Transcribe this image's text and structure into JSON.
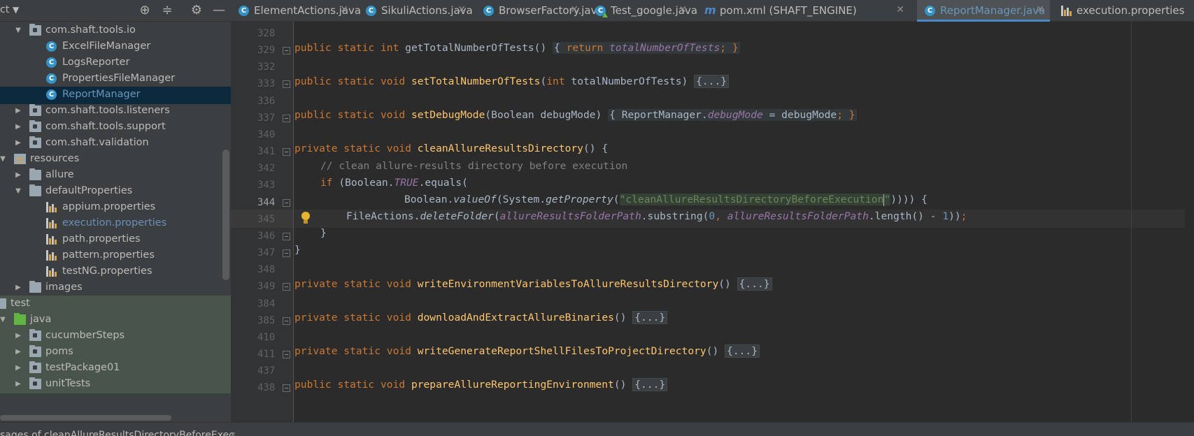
{
  "project_panel": {
    "title": "ct",
    "icons": [
      "locate-icon",
      "collapse-icon",
      "gear-icon",
      "minimize-icon"
    ],
    "tree": [
      {
        "label": "com.shaft.tools.io",
        "icon": "package",
        "expanded": true,
        "depth": 1
      },
      {
        "label": "ExcelFileManager",
        "icon": "class",
        "depth": 2
      },
      {
        "label": "LogsReporter",
        "icon": "class",
        "depth": 2
      },
      {
        "label": "PropertiesFileManager",
        "icon": "class",
        "depth": 2
      },
      {
        "label": "ReportManager",
        "icon": "class",
        "depth": 2,
        "selected": true
      },
      {
        "label": "com.shaft.tools.listeners",
        "icon": "package",
        "expanded": false,
        "depth": 1
      },
      {
        "label": "com.shaft.tools.support",
        "icon": "package",
        "expanded": false,
        "depth": 1
      },
      {
        "label": "com.shaft.validation",
        "icon": "package",
        "expanded": false,
        "depth": 1
      },
      {
        "label": "resources",
        "icon": "resources",
        "expanded": true,
        "depth": 0
      },
      {
        "label": "allure",
        "icon": "folder",
        "expanded": false,
        "depth": 1
      },
      {
        "label": "defaultProperties",
        "icon": "folder",
        "expanded": true,
        "depth": 1
      },
      {
        "label": "appium.properties",
        "icon": "properties",
        "depth": 2
      },
      {
        "label": "execution.properties",
        "icon": "properties",
        "depth": 2,
        "highlight": true
      },
      {
        "label": "path.properties",
        "icon": "properties",
        "depth": 2
      },
      {
        "label": "pattern.properties",
        "icon": "properties",
        "depth": 2
      },
      {
        "label": "testNG.properties",
        "icon": "properties",
        "depth": 2
      },
      {
        "label": "images",
        "icon": "folder",
        "expanded": false,
        "depth": 1
      },
      {
        "label": "test",
        "icon": "folder",
        "depth": -1,
        "test": true
      },
      {
        "label": "java",
        "icon": "folder-green",
        "expanded": true,
        "depth": 0,
        "test": true
      },
      {
        "label": "cucumberSteps",
        "icon": "package",
        "expanded": false,
        "depth": 1,
        "test": true
      },
      {
        "label": "poms",
        "icon": "package",
        "expanded": false,
        "depth": 1,
        "test": true
      },
      {
        "label": "testPackage01",
        "icon": "package",
        "expanded": false,
        "depth": 1,
        "test": true
      },
      {
        "label": "unitTests",
        "icon": "package",
        "expanded": false,
        "depth": 1,
        "test": true
      }
    ]
  },
  "tabs": [
    {
      "label": "ElementActions.java",
      "icon": "class",
      "active": false
    },
    {
      "label": "SikuliActions.java",
      "icon": "class",
      "active": false
    },
    {
      "label": "BrowserFactory.java",
      "icon": "class",
      "active": false
    },
    {
      "label": "Test_google.java",
      "icon": "test-class",
      "active": false
    },
    {
      "label": "pom.xml (SHAFT_ENGINE)",
      "icon": "maven",
      "active": false
    },
    {
      "label": "ReportManager.java",
      "icon": "class",
      "active": true
    },
    {
      "label": "execution.properties",
      "icon": "properties",
      "active": false
    }
  ],
  "editor": {
    "current_line": "344",
    "lines": [
      {
        "no": "328",
        "fold": false
      },
      {
        "no": "329",
        "fold": true
      },
      {
        "no": "332",
        "fold": false
      },
      {
        "no": "333",
        "fold": true
      },
      {
        "no": "336",
        "fold": false
      },
      {
        "no": "337",
        "fold": true
      },
      {
        "no": "340",
        "fold": false
      },
      {
        "no": "341",
        "fold": true
      },
      {
        "no": "342",
        "fold": false
      },
      {
        "no": "343",
        "fold": false
      },
      {
        "no": "344",
        "fold": true
      },
      {
        "no": "345",
        "fold": false
      },
      {
        "no": "346",
        "fold": true
      },
      {
        "no": "347",
        "fold": true
      },
      {
        "no": "348",
        "fold": false
      },
      {
        "no": "349",
        "fold": true
      },
      {
        "no": "384",
        "fold": false
      },
      {
        "no": "385",
        "fold": true
      },
      {
        "no": "410",
        "fold": false
      },
      {
        "no": "411",
        "fold": true
      },
      {
        "no": "437",
        "fold": false
      },
      {
        "no": "438",
        "fold": true
      }
    ],
    "code": {
      "l329": {
        "mod": "public static int ",
        "fn": "getTotalNumberOfTests",
        "paren": "() ",
        "fold_open": "{ ",
        "ret": "return ",
        "field": "totalNumberOfTests",
        "fold_close": "; }"
      },
      "l333": {
        "mod": "public static void ",
        "fn": "setTotalNumberOfTests",
        "p1": "(",
        "type": "int ",
        "p2": "totalNumberOfTests) ",
        "folded": "{...}"
      },
      "l337": {
        "mod": "public static void ",
        "fn": "setDebugMode",
        "p1": "(Boolean debugMode) ",
        "fold_open": "{ ",
        "cls": "ReportManager.",
        "field": "debugMode",
        "rest": " = debugMode",
        "fold_close": "; }"
      },
      "l341": {
        "mod": "private static void ",
        "fn": "cleanAllureResultsDirectory",
        "rest": "() {"
      },
      "l342": {
        "comment": "// clean allure-results directory before execution"
      },
      "l343": {
        "kw": "if ",
        "p1": "(Boolean.",
        "const": "TRUE",
        "p2": ".equals("
      },
      "l344": {
        "p1": "Boolean.",
        "m1": "valueOf",
        "p2": "(System.",
        "m2": "getProperty",
        "p3": "(",
        "q1": "\"",
        "str": "cleanAllureResultsDirectoryBeforeExecution",
        "q2": "\"",
        "p4": ")))) {"
      },
      "l345": {
        "p1": "FileActions.",
        "m1": "deleteFolder",
        "p2": "(",
        "f1": "allureResultsFolderPath",
        "p3": ".substring(",
        "n1": "0",
        "comma": ", ",
        "f2": "allureResultsFolderPath",
        "p4": ".length() - ",
        "n2": "1",
        "p5": "))",
        "semi": ";"
      },
      "l346": {
        "text": "}"
      },
      "l347": {
        "text": "}"
      },
      "l349": {
        "mod": "private static void ",
        "fn": "writeEnvironmentVariablesToAllureResultsDirectory",
        "paren": "() ",
        "folded": "{...}"
      },
      "l385": {
        "mod": "private static void ",
        "fn": "downloadAndExtractAllureBinaries",
        "paren": "() ",
        "folded": "{...}"
      },
      "l411": {
        "mod": "private static void ",
        "fn": "writeGenerateReportShellFilesToProjectDirectory",
        "paren": "() ",
        "folded": "{...}"
      },
      "l438": {
        "mod": "public static void ",
        "fn": "prepareAllureReportingEnvironment",
        "paren": "() ",
        "folded": "{...}"
      }
    }
  },
  "bottom": {
    "text": "sages of cleanAllureResultsDirectoryBeforeExec",
    "close": "×"
  },
  "colors": {
    "accent": "#4a88c7",
    "selection": "#0d293e",
    "keyword": "#cc7832",
    "method": "#ffc66d",
    "field": "#9876aa",
    "string": "#6a8759",
    "comment": "#808080",
    "number": "#6897bb"
  }
}
